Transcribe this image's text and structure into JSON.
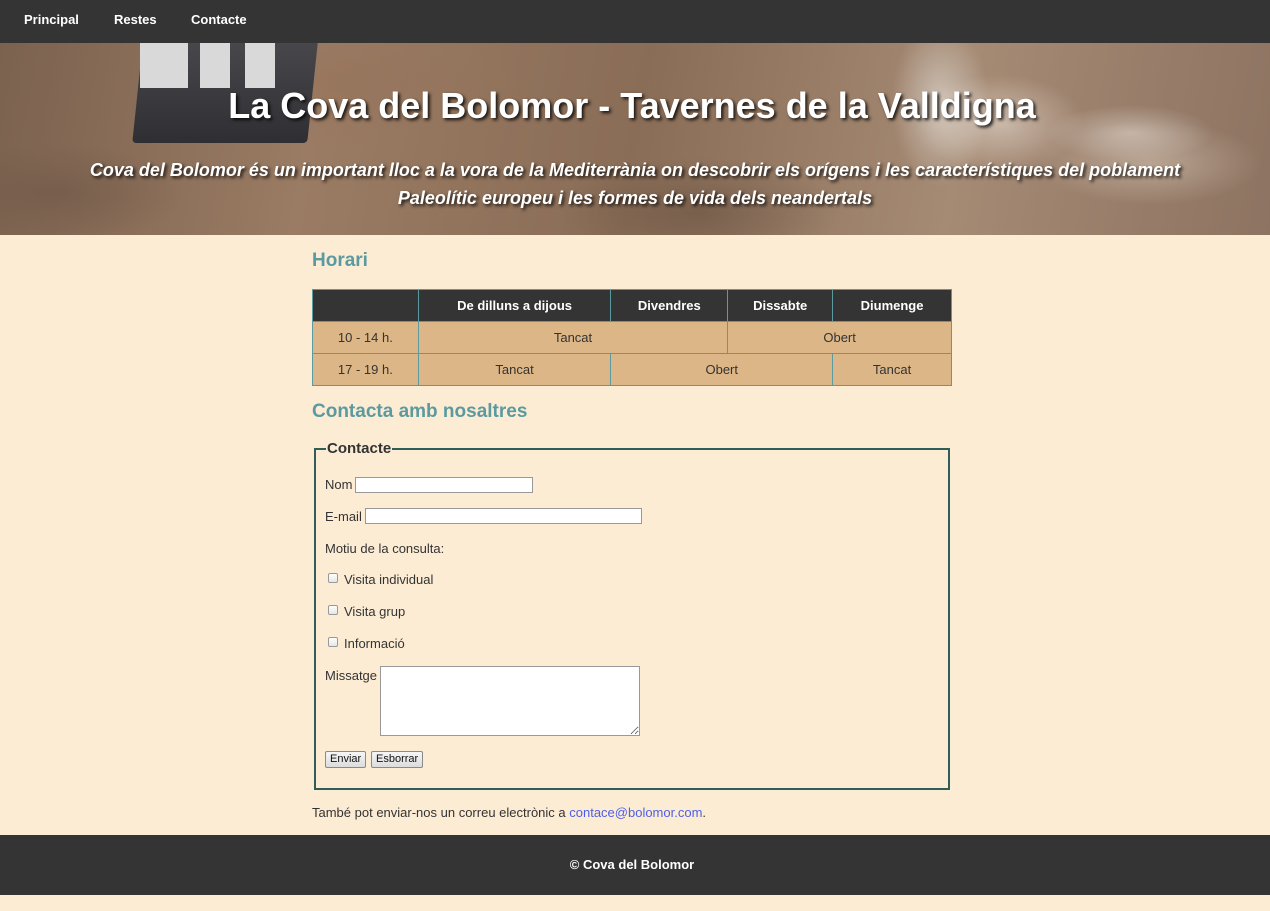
{
  "nav": {
    "items": [
      {
        "label": "Principal"
      },
      {
        "label": "Restes"
      },
      {
        "label": "Contacte"
      }
    ]
  },
  "hero": {
    "title": "La Cova del Bolomor - Tavernes de la Valldigna",
    "tagline_line1": "Cova del Bolomor és un important lloc a la vora de la Mediterrània on descobrir els orígens i les característiques del poblament",
    "tagline_line2": "Paleolític europeu i les formes de vida dels neandertals"
  },
  "schedule": {
    "title": "Horari",
    "headers": [
      "",
      "De dilluns a dijous",
      "Divendres",
      "Dissabte",
      "Diumenge"
    ],
    "rows": [
      {
        "time": "10 - 14 h.",
        "cells": [
          "Tancat",
          "Obert"
        ]
      },
      {
        "time": "17 - 19 h.",
        "cells": [
          "Tancat",
          "Obert",
          "Tancat"
        ]
      }
    ]
  },
  "contact": {
    "title": "Contacta amb nosaltres",
    "legend": "Contacte",
    "name_label": "Nom",
    "name_value": "",
    "email_label": "E-mail",
    "email_value": "",
    "reason_label": "Motiu de la consulta:",
    "options": [
      {
        "label": "Visita individual",
        "checked": false
      },
      {
        "label": "Visita grup",
        "checked": false
      },
      {
        "label": "Informació",
        "checked": false
      }
    ],
    "message_label": "Missatge",
    "message_value": "",
    "submit_label": "Enviar",
    "reset_label": "Esborrar",
    "email_note_prefix": "També pot enviar-nos un correu electrònic a ",
    "email_link": "contace@bolomor.com",
    "email_note_suffix": "."
  },
  "footer": {
    "text": "© Cova del Bolomor"
  },
  "colors": {
    "nav_bg": "#343434",
    "page_bg": "#fdecd4",
    "heading": "#5b9aa0",
    "table_cell": "#dcb686",
    "link": "#4d5ee8"
  }
}
